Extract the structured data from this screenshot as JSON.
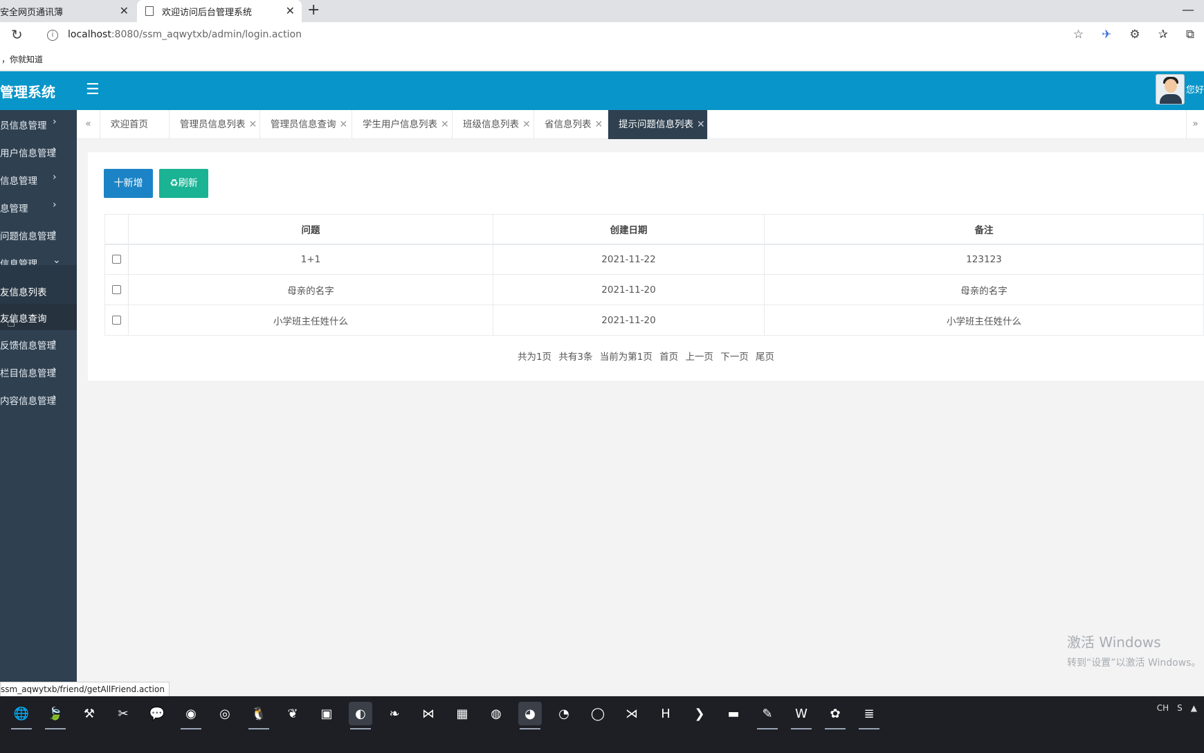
{
  "browser": {
    "tabs": [
      {
        "title": "安全网页通讯薄"
      },
      {
        "title": "欢迎访问后台管理系统"
      }
    ],
    "url_host": "localhost",
    "url_path": ":8080/ssm_aqwytxb/admin/login.action",
    "bookmark": "，你就知道",
    "status_url": "ssm_aqwytxb/friend/getAllFriend.action"
  },
  "header": {
    "brand": "管理系统",
    "greeting": "您好"
  },
  "sidebar": {
    "items": [
      {
        "label": "员信息管理",
        "chevron": "›"
      },
      {
        "label": "用户信息管理",
        "chevron": "›"
      },
      {
        "label": "信息管理",
        "chevron": "›"
      },
      {
        "label": "息管理",
        "chevron": "›"
      },
      {
        "label": "问题信息管理",
        "chevron": "›"
      },
      {
        "label": "信息管理",
        "chevron": "⌄"
      }
    ],
    "subitems": [
      {
        "label": "友信息列表"
      },
      {
        "label": "友信息查询"
      }
    ],
    "items_after": [
      {
        "label": "反馈信息管理",
        "chevron": "›"
      },
      {
        "label": "栏目信息管理",
        "chevron": "›"
      },
      {
        "label": "内容信息管理",
        "chevron": "›"
      }
    ]
  },
  "content_tabs": [
    {
      "label": "欢迎首页",
      "closable": false
    },
    {
      "label": "管理员信息列表",
      "closable": true
    },
    {
      "label": "管理员信息查询",
      "closable": true
    },
    {
      "label": "学生用户信息列表",
      "closable": true
    },
    {
      "label": "班级信息列表",
      "closable": true
    },
    {
      "label": "省信息列表",
      "closable": true
    },
    {
      "label": "提示问题信息列表",
      "closable": true,
      "active": true
    }
  ],
  "toolbar": {
    "add_label": "十新增",
    "refresh_label": "♻刷新"
  },
  "table": {
    "columns": [
      "问题",
      "创建日期",
      "备注"
    ],
    "rows": [
      {
        "question": "1+1",
        "date": "2021-11-22",
        "remark": "123123"
      },
      {
        "question": "母亲的名字",
        "date": "2021-11-20",
        "remark": "母亲的名字"
      },
      {
        "question": "小学班主任姓什么",
        "date": "2021-11-20",
        "remark": "小学班主任姓什么"
      }
    ]
  },
  "pager": {
    "total_pages": "共为1页",
    "total_items": "共有3条",
    "current": "当前为第1页",
    "first": "首页",
    "prev": "上一页",
    "next": "下一页",
    "last": "尾页"
  },
  "watermark": {
    "line1": "激活 Windows",
    "line2": "转到“设置”以激活 Windows。"
  },
  "taskbar": {
    "ime": "CH"
  },
  "colors": {
    "header": "#0895c9",
    "sidebar": "#2f4050",
    "add_button": "#1c84c6",
    "refresh_button": "#1ab394"
  }
}
